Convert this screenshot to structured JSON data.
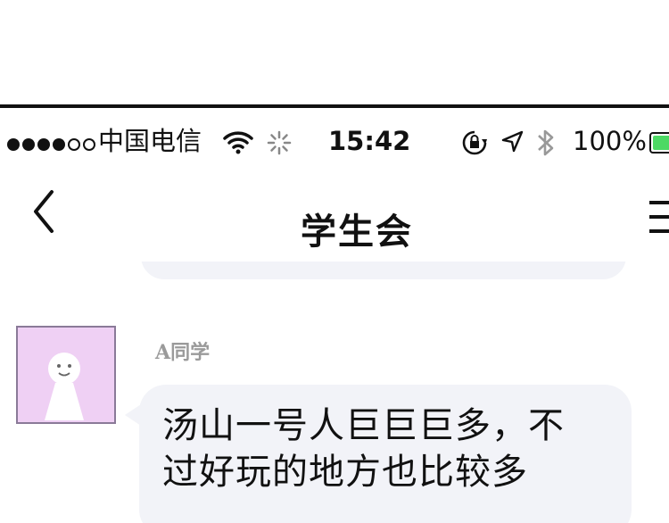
{
  "status_bar": {
    "signal_filled": 4,
    "signal_empty": 2,
    "carrier": "中国电信",
    "time": "15:42",
    "battery_percent": "100%",
    "battery_level": 1.0,
    "icons": [
      "wifi-icon",
      "activity-spinner-icon",
      "rotation-lock-icon",
      "location-arrow-icon",
      "bluetooth-icon",
      "battery-icon"
    ],
    "battery_color": "#4cd964"
  },
  "nav": {
    "title": "学生会",
    "back_icon": "chevron-left-icon",
    "menu_icon": "menu-icon"
  },
  "chat": {
    "messages": [
      {
        "sender": "A同学",
        "text": "汤山一号人巨巨巨多，不\n过好玩的地方也比较多",
        "avatar_color": "#efd0f4"
      }
    ],
    "bubble_color": "#f2f3f8"
  }
}
